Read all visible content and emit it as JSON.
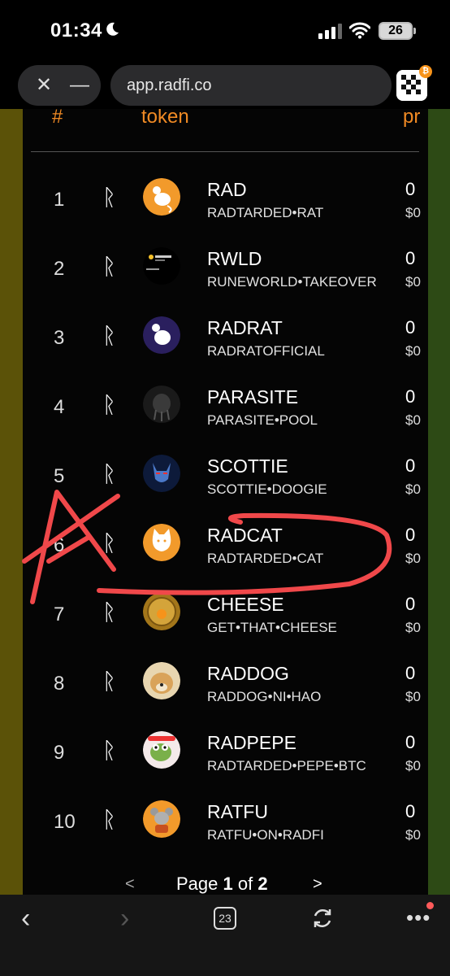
{
  "status_bar": {
    "time": "01:34",
    "battery": "26"
  },
  "browser": {
    "url": "app.radfi.co",
    "close_glyph": "✕",
    "minimize_glyph": "—",
    "extension_badge": "₿"
  },
  "table": {
    "headers": {
      "rank": "#",
      "token": "token",
      "price": "pr"
    },
    "rows": [
      {
        "rank": "1",
        "rune": "ᚱ",
        "name": "RAD",
        "subtitle": "RADTARDED•RAT",
        "price": "0",
        "usd": "$0"
      },
      {
        "rank": "2",
        "rune": "ᚱ",
        "name": "RWLD",
        "subtitle": "RUNEWORLD•TAKEOVER",
        "price": "0",
        "usd": "$0"
      },
      {
        "rank": "3",
        "rune": "ᚱ",
        "name": "RADRAT",
        "subtitle": "RADRATOFFICIAL",
        "price": "0",
        "usd": "$0"
      },
      {
        "rank": "4",
        "rune": "ᚱ",
        "name": "PARASITE",
        "subtitle": "PARASITE•POOL",
        "price": "0",
        "usd": "$0"
      },
      {
        "rank": "5",
        "rune": "ᚱ",
        "name": "SCOTTIE",
        "subtitle": "SCOTTIE•DOOGIE",
        "price": "0",
        "usd": "$0"
      },
      {
        "rank": "6",
        "rune": "ᚱ",
        "name": "RADCAT",
        "subtitle": "RADTARDED•CAT",
        "price": "0",
        "usd": "$0"
      },
      {
        "rank": "7",
        "rune": "ᚱ",
        "name": "CHEESE",
        "subtitle": "GET•THAT•CHEESE",
        "price": "0",
        "usd": "$0"
      },
      {
        "rank": "8",
        "rune": "ᚱ",
        "name": "RADDOG",
        "subtitle": "RADDOG•NI•HAO",
        "price": "0",
        "usd": "$0"
      },
      {
        "rank": "9",
        "rune": "ᚱ",
        "name": "RADPEPE",
        "subtitle": "RADTARDED•PEPE•BTC",
        "price": "0",
        "usd": "$0"
      },
      {
        "rank": "10",
        "rune": "ᚱ",
        "name": "RATFU",
        "subtitle": "RATFU•ON•RADFI",
        "price": "0",
        "usd": "$0"
      }
    ]
  },
  "pagination": {
    "prev": "<",
    "label_prefix": "Page ",
    "current": "1",
    "label_mid": " of ",
    "total": "2",
    "next": ">"
  },
  "toolbar": {
    "back": "‹",
    "forward": "›",
    "tab_count": "23",
    "more": "•••"
  },
  "colors": {
    "accent": "#f08a24",
    "annotation": "#f0484a",
    "side_left": "#5b5208",
    "side_right": "#2d4a15"
  }
}
